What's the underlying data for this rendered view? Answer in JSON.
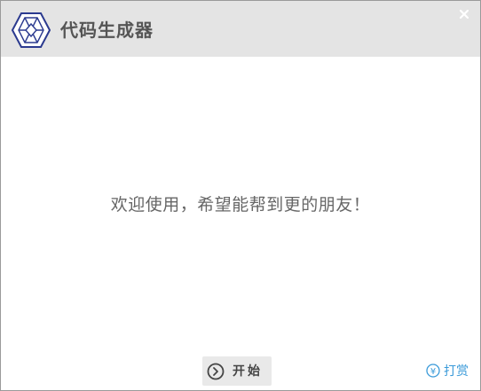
{
  "titlebar": {
    "title": "代码生成器",
    "logo_icon": "hexagon-logo-icon",
    "close_symbol": "×"
  },
  "main": {
    "welcome_text": "欢迎使用，希望能帮到更的朋友！"
  },
  "footer": {
    "start_label": "开始",
    "start_icon": "chevron-right-circle-icon",
    "reward_label": "打赏",
    "reward_icon_glyph": "¥",
    "reward_color": "#3a9ad9"
  },
  "colors": {
    "titlebar_bg": "#e4e4e4",
    "logo_stroke": "#2b3a8f",
    "text_gray": "#666666"
  }
}
